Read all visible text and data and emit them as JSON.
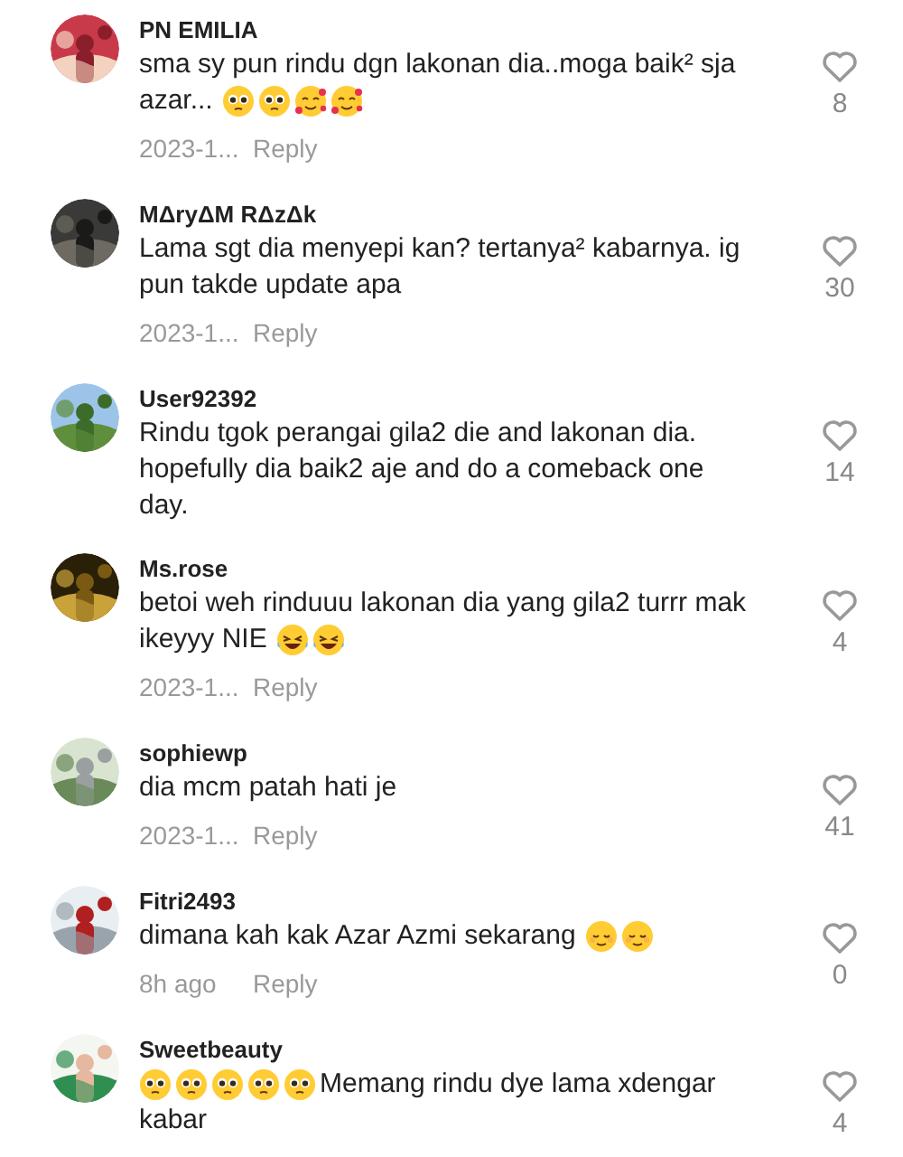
{
  "comments": [
    {
      "username": "PN EMILIA",
      "lines": [
        [
          {
            "kind": "text",
            "text": "sma sy pun rindu dgn lakonan dia..moga baik² sja"
          }
        ],
        [
          {
            "kind": "text",
            "text": "azar..."
          },
          {
            "kind": "pleading-emoji"
          },
          {
            "kind": "pleading-emoji"
          },
          {
            "kind": "hearts-emoji"
          },
          {
            "kind": "hearts-emoji"
          }
        ]
      ],
      "time": "2023-1...",
      "reply": "Reply",
      "likes": "8"
    },
    {
      "username": "MΔryΔM RΔzΔk",
      "lines": [
        [
          {
            "kind": "text",
            "text": "Lama sgt dia menyepi kan? tertanya² kabarnya. ig"
          }
        ],
        [
          {
            "kind": "text",
            "text": "pun takde update apa"
          }
        ]
      ],
      "time": "2023-1...",
      "reply": "Reply",
      "likes": "30"
    },
    {
      "username": "User92392",
      "lines": [
        [
          {
            "kind": "text",
            "text": "Rindu tgok perangai gila2 die and lakonan dia."
          }
        ],
        [
          {
            "kind": "text",
            "text": "hopefully dia baik2 aje and do a comeback one"
          }
        ],
        [
          {
            "kind": "text",
            "text": "day."
          }
        ]
      ],
      "likes": "14"
    },
    {
      "username": "Ms.rose",
      "lines": [
        [
          {
            "kind": "text",
            "text": "betoi weh rinduuu lakonan dia yang gila2 turrr mak"
          }
        ],
        [
          {
            "kind": "text",
            "text": "ikeyyy NIE"
          },
          {
            "kind": "laughing-emoji"
          },
          {
            "kind": "laughing-emoji"
          }
        ]
      ],
      "time": "2023-1...",
      "reply": "Reply",
      "likes": "4"
    },
    {
      "username": "sophiewp",
      "lines": [
        [
          {
            "kind": "text",
            "text": "dia mcm patah hati je"
          }
        ]
      ],
      "time": "2023-1...",
      "reply": "Reply",
      "likes": "41"
    },
    {
      "username": "Fitri2493",
      "lines": [
        [
          {
            "kind": "text",
            "text": "dimana kah kak Azar Azmi sekarang"
          },
          {
            "kind": "relieved-emoji"
          },
          {
            "kind": "relieved-emoji"
          }
        ]
      ],
      "time": "8h ago",
      "reply": "Reply",
      "likes": "0"
    },
    {
      "username": "Sweetbeauty",
      "lines": [
        [
          {
            "kind": "pleading-emoji"
          },
          {
            "kind": "pleading-emoji"
          },
          {
            "kind": "pleading-emoji"
          },
          {
            "kind": "pleading-emoji"
          },
          {
            "kind": "pleading-emoji"
          },
          {
            "kind": "text",
            "text": "Memang rindu dye lama xdengar"
          }
        ],
        [
          {
            "kind": "text",
            "text": "kabar"
          }
        ]
      ],
      "likes": "4"
    }
  ]
}
